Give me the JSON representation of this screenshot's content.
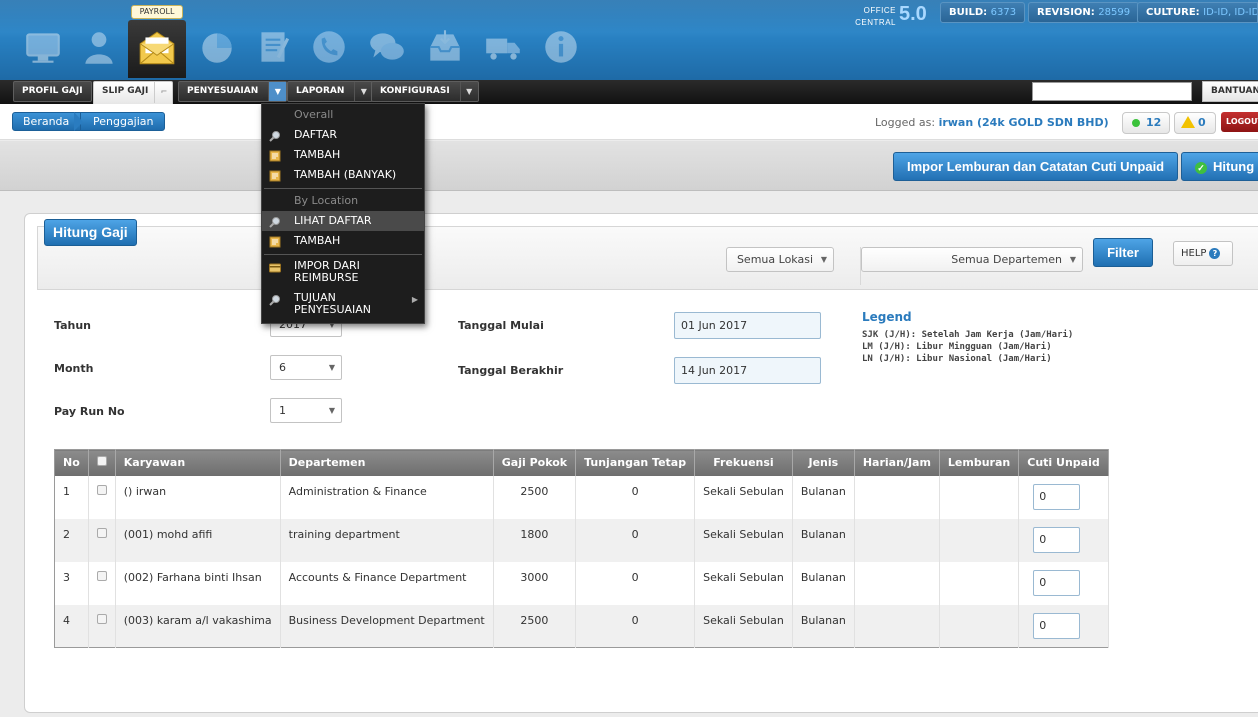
{
  "header": {
    "payroll_tip": "PAYROLL",
    "logo_small_1": "OFFICE",
    "logo_small_2": "CENTRAL",
    "logo_version": "5.0",
    "build_label": "BUILD:",
    "build_value": "6373",
    "revision_label": "REVISION:",
    "revision_value": "28599",
    "culture_label": "CULTURE:",
    "culture_value": "ID-ID, ID-ID"
  },
  "apps": [
    {
      "name": "desktop-icon"
    },
    {
      "name": "user-icon"
    },
    {
      "name": "envelope-icon"
    },
    {
      "name": "pie-chart-icon"
    },
    {
      "name": "notepad-icon"
    },
    {
      "name": "phone-icon"
    },
    {
      "name": "chat-icon"
    },
    {
      "name": "inbox-icon"
    },
    {
      "name": "truck-icon"
    },
    {
      "name": "info-icon"
    }
  ],
  "menu": {
    "profil_gaji": "PROFIL GAJI",
    "slip_gaji": "SLIP GAJI",
    "penyesuaian": "PENYESUAIAN",
    "laporan": "LAPORAN",
    "konfigurasi": "KONFIGURASI",
    "bantuan": "BANTUAN"
  },
  "breadcrumb": {
    "home": "Beranda",
    "current": "Penggajian"
  },
  "session": {
    "logged_as_label": "Logged as:",
    "user": "irwan (24k GOLD SDN BHD)",
    "online_count": "12",
    "alert_count": "0",
    "logout": "LOGOUT"
  },
  "actions": {
    "import_button": "Impor Lemburan dan Catatan Cuti Unpaid",
    "hitung_button": "Hitung"
  },
  "panel": {
    "title": "Hitung Gaji",
    "location_select": "Semua Lokasi",
    "department_select": "Semua Departemen",
    "filter_button": "Filter",
    "help_button": "HELP"
  },
  "form": {
    "tahun_label": "Tahun",
    "tahun_value": "2017",
    "month_label": "Month",
    "month_value": "6",
    "payrun_label": "Pay Run No",
    "payrun_value": "1",
    "tanggal_mulai_label": "Tanggal Mulai",
    "tanggal_mulai_value": "01 Jun 2017",
    "tanggal_berakhir_label": "Tanggal Berakhir",
    "tanggal_berakhir_value": "14 Jun 2017"
  },
  "legend": {
    "title": "Legend",
    "items": [
      "SJK (J/H): Setelah Jam Kerja (Jam/Hari)",
      "LM (J/H): Libur Mingguan (Jam/Hari)",
      "LN (J/H): Libur Nasional (Jam/Hari)"
    ]
  },
  "table": {
    "headers": [
      "No",
      "",
      "Karyawan",
      "Departemen",
      "Gaji Pokok",
      "Tunjangan Tetap",
      "Frekuensi",
      "Jenis",
      "Harian/Jam",
      "Lemburan",
      "Cuti Unpaid"
    ],
    "rows": [
      {
        "no": "1",
        "karyawan": "() irwan",
        "departemen": "Administration & Finance",
        "gaji": "2500",
        "tunjangan": "0",
        "frekuensi": "Sekali Sebulan",
        "jenis": "Bulanan",
        "harian": "",
        "lemburan": "",
        "cuti": "0"
      },
      {
        "no": "2",
        "karyawan": "(001) mohd afifi",
        "departemen": "training department",
        "gaji": "1800",
        "tunjangan": "0",
        "frekuensi": "Sekali Sebulan",
        "jenis": "Bulanan",
        "harian": "",
        "lemburan": "",
        "cuti": "0"
      },
      {
        "no": "3",
        "karyawan": "(002) Farhana binti Ihsan",
        "departemen": "Accounts & Finance Department",
        "gaji": "3000",
        "tunjangan": "0",
        "frekuensi": "Sekali Sebulan",
        "jenis": "Bulanan",
        "harian": "",
        "lemburan": "",
        "cuti": "0"
      },
      {
        "no": "4",
        "karyawan": "(003) karam a/l vakashima",
        "departemen": "Business Development Department",
        "gaji": "2500",
        "tunjangan": "0",
        "frekuensi": "Sekali Sebulan",
        "jenis": "Bulanan",
        "harian": "",
        "lemburan": "",
        "cuti": "0"
      }
    ]
  },
  "dropdown": {
    "group_overall": "Overall",
    "daftar": "DAFTAR",
    "tambah": "TAMBAH",
    "tambah_banyak": "TAMBAH (BANYAK)",
    "group_location": "By Location",
    "lihat_daftar": "LIHAT DAFTAR",
    "tambah_loc": "TAMBAH",
    "impor_1": "IMPOR DARI",
    "impor_2": "REIMBURSE",
    "tujuan_1": "TUJUAN",
    "tujuan_2": "PENYESUAIAN"
  },
  "colors": {
    "header_blue": "#2a84c6",
    "accent_blue": "#2b7bbd",
    "logout_red": "#c43030"
  }
}
